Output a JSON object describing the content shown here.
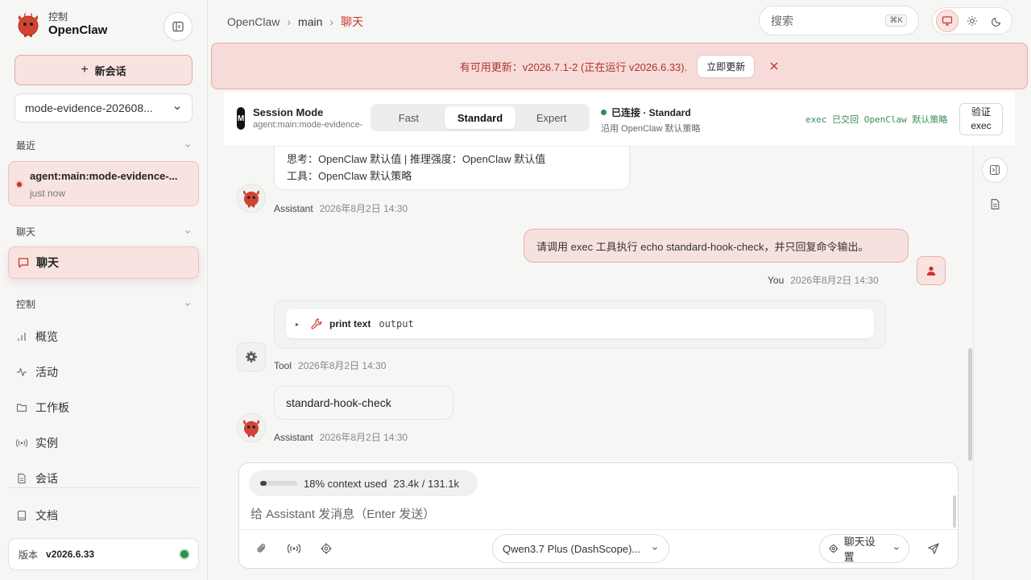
{
  "sidebar": {
    "brand_small": "控制",
    "brand_name": "OpenClaw",
    "new_session": "新会话",
    "session_select": "mode-evidence-202608...",
    "recent_label": "最近",
    "recent_title": "agent:main:mode-evidence-...",
    "recent_time": "just now",
    "chat_section": "聊天",
    "chat_item": "聊天",
    "control_section": "控制",
    "nav": {
      "overview": "概览",
      "activity": "活动",
      "board": "工作板",
      "instances": "实例",
      "sessions": "会话",
      "docs": "文档"
    },
    "version_label": "版本",
    "version_value": "v2026.6.33"
  },
  "topbar": {
    "crumb1": "OpenClaw",
    "crumb2": "main",
    "crumb3": "聊天",
    "search_placeholder": "搜索",
    "search_kbd": "⌘K"
  },
  "banner": {
    "text": "有可用更新：v2026.7.1-2 (正在运行 v2026.6.33).",
    "button": "立即更新"
  },
  "mode": {
    "badge": "M",
    "title": "Session Mode",
    "subtitle": "agent:main:mode-evidence-",
    "options": [
      "Fast",
      "Standard",
      "Expert"
    ],
    "selected": "Standard",
    "status": "已连接 · Standard",
    "status_sub": "沿用 OpenClaw 默认策略",
    "exec_note": "exec 已交回 OpenClaw 默认策略",
    "verify_line1": "验证",
    "verify_line2": "exec"
  },
  "messages": {
    "m1_line1": "思考：OpenClaw 默认值 | 推理强度：OpenClaw 默认值",
    "m1_line2": "工具：OpenClaw 默认策略",
    "m1_author": "Assistant",
    "m1_time": "2026年8月2日 14:30",
    "user_text": "请调用 exec 工具执行 echo standard-hook-check，并只回复命令输出。",
    "user_author": "You",
    "user_time": "2026年8月2日 14:30",
    "tool_name": "print text",
    "tool_output": "output",
    "tool_author": "Tool",
    "tool_time": "2026年8月2日 14:30",
    "m3_text": "standard-hook-check",
    "m3_author": "Assistant",
    "m3_time": "2026年8月2日 14:30"
  },
  "composer": {
    "context_text": "18% context used",
    "context_nums": "23.4k / 131.1k",
    "context_fraction": 0.18,
    "placeholder": "给 Assistant 发消息（Enter 发送）",
    "model": "Qwen3.7 Plus (DashScope)...",
    "settings": "聊天设置"
  },
  "colors": {
    "accent": "#c7332b",
    "accent_soft": "#f9e3e1",
    "ok": "#2f8f4a"
  }
}
